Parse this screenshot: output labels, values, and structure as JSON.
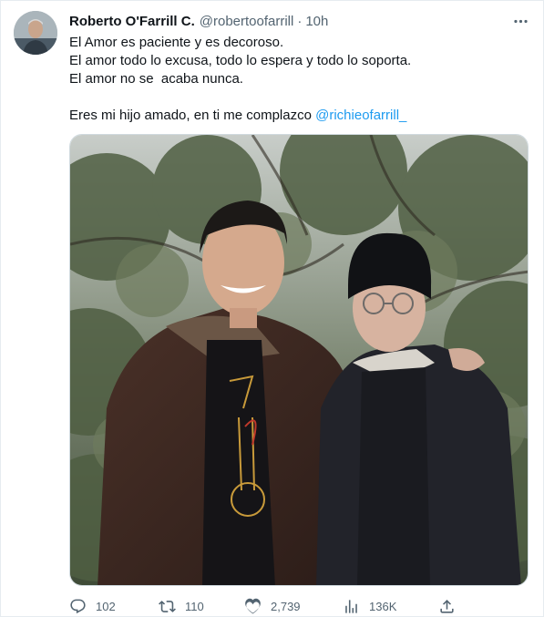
{
  "tweet": {
    "author": {
      "display_name": "Roberto O'Farrill C.",
      "handle": "@robertoofarrill",
      "separator": "·",
      "time": "10h",
      "avatar_icon": "profile-photo"
    },
    "text": {
      "line1": "El Amor es paciente y es decoroso.",
      "line2": "El amor todo lo excusa, todo lo espera y todo lo soporta.",
      "line3": "El amor no se  acaba nunca.",
      "line4_prefix": "Eres mi hijo amado, en ti me complazco ",
      "mention": "@richieofarrill_"
    },
    "media": {
      "type": "photo",
      "accent_colors": {
        "foliage": "#4a5a3e",
        "jacket": "#3a2622",
        "coat": "#22232a"
      }
    },
    "metrics": {
      "replies": "102",
      "reposts": "110",
      "likes": "2,739",
      "views": "136K"
    },
    "icons": {
      "more": "more-icon",
      "reply": "reply-icon",
      "repost": "repost-icon",
      "like": "like-icon",
      "views": "views-icon",
      "share": "share-icon"
    },
    "colors": {
      "text_primary": "#0f1419",
      "text_secondary": "#536471",
      "link": "#1d9bf0",
      "border": "#cfd9de"
    }
  }
}
